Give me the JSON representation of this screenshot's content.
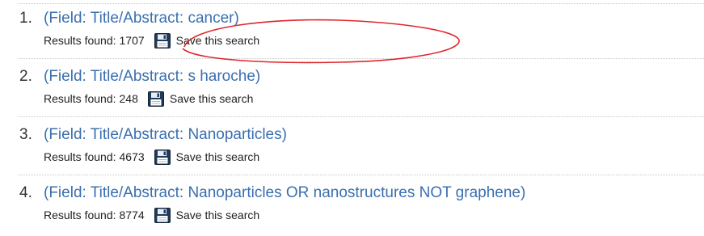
{
  "history": {
    "entries": [
      {
        "number": "1.",
        "query": "(Field: Title/Abstract: cancer)",
        "results_label": "Results found:",
        "results_count": "1707",
        "save_label": "Save this search"
      },
      {
        "number": "2.",
        "query": "(Field: Title/Abstract: s haroche)",
        "results_label": "Results found:",
        "results_count": "248",
        "save_label": "Save this search"
      },
      {
        "number": "3.",
        "query": "(Field: Title/Abstract: Nanoparticles)",
        "results_label": "Results found:",
        "results_count": "4673",
        "save_label": "Save this search"
      },
      {
        "number": "4.",
        "query": "(Field: Title/Abstract: Nanoparticles OR nanostructures NOT graphene)",
        "results_label": "Results found:",
        "results_count": "8774",
        "save_label": "Save this search"
      }
    ]
  },
  "colors": {
    "link": "#3a6fb0",
    "text": "#222222",
    "annotation": "#e0262b",
    "separator": "#c7c7c7"
  },
  "icons": {
    "save": "floppy-disk-icon"
  }
}
